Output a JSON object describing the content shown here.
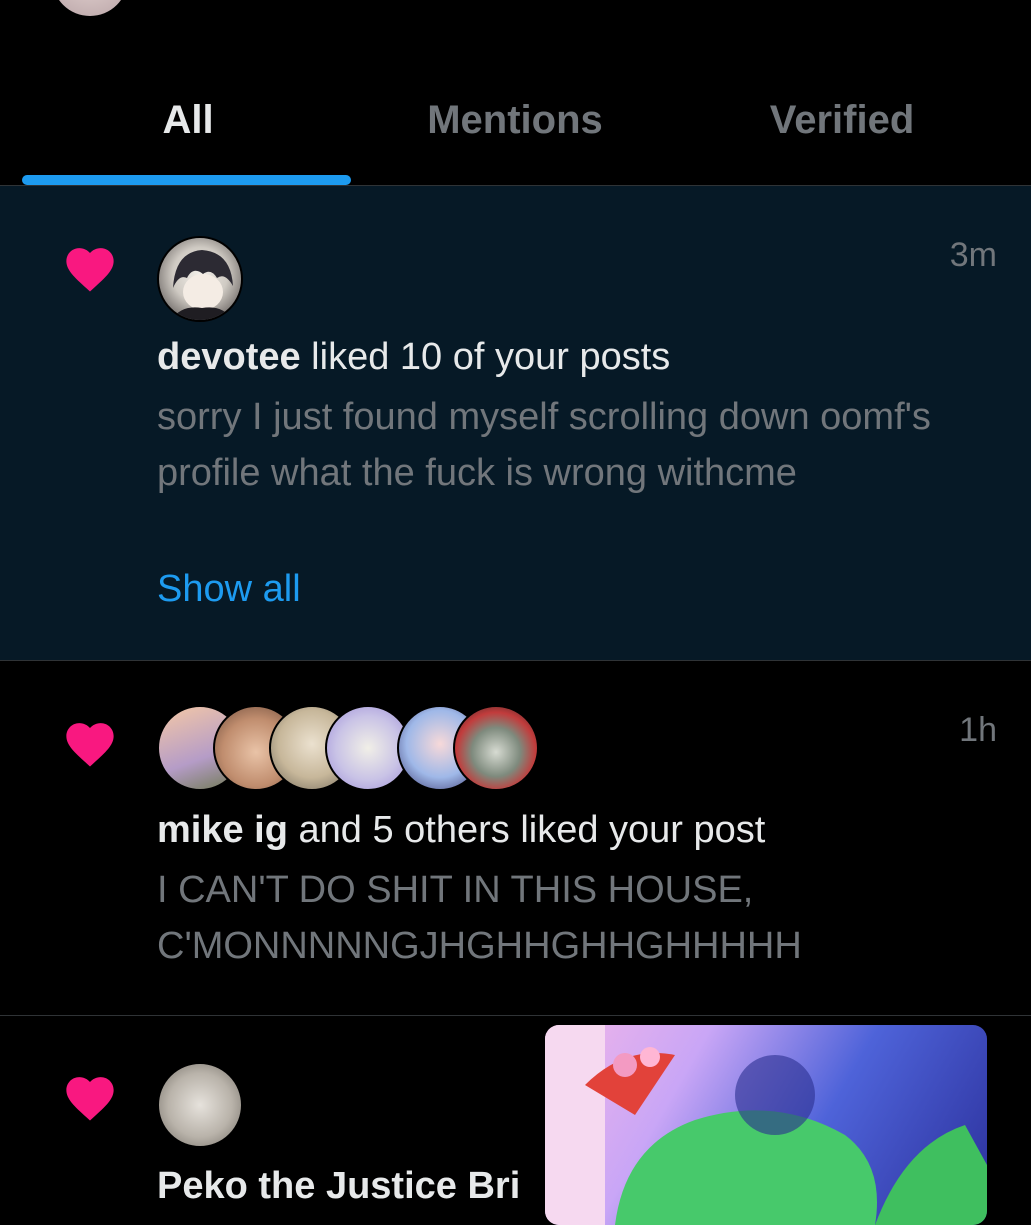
{
  "tabs": [
    {
      "label": "All",
      "active": true
    },
    {
      "label": "Mentions",
      "active": false
    },
    {
      "label": "Verified",
      "active": false
    }
  ],
  "notifications": [
    {
      "type": "like",
      "unread": true,
      "time": "3m",
      "user": "devotee",
      "action": " liked 10 of your posts",
      "snippet": "sorry I just found myself scrolling down oomf's profile what the fuck is wrong withcme",
      "show_all": "Show all"
    },
    {
      "type": "like",
      "unread": false,
      "time": "1h",
      "user": "mike ig",
      "action": " and 5 others liked your post",
      "snippet": "I CAN'T DO SHIT IN THIS HOUSE, C'MONNNNNGJHGHHGHHGHHHHH",
      "avatar_count": 6
    },
    {
      "type": "like",
      "unread": false,
      "user": "Peko the Justice Bri"
    }
  ],
  "colors": {
    "heart": "#f91880",
    "accent": "#1d9bf0",
    "unread_bg": "#061926",
    "muted_text": "#71767b"
  },
  "icons": {
    "heart": "heart-icon"
  }
}
